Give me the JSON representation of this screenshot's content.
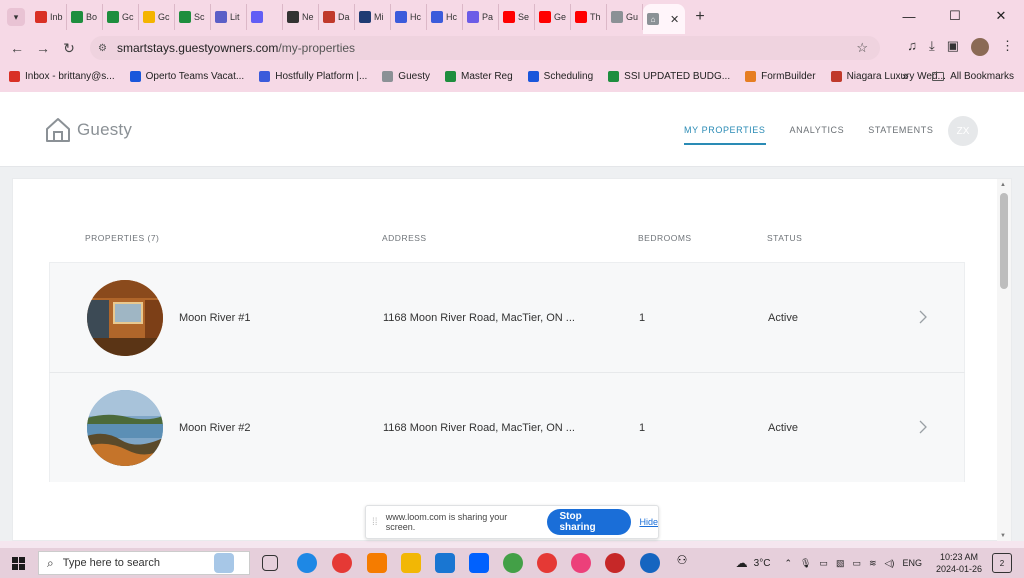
{
  "browser": {
    "tabs": [
      {
        "label": "Inb",
        "icon": "gmail-icon",
        "color": "#d93025"
      },
      {
        "label": "Bo",
        "icon": "sheets-icon",
        "color": "#1e8e3e"
      },
      {
        "label": "Gc",
        "icon": "sheets-icon",
        "color": "#1e8e3e"
      },
      {
        "label": "Gc",
        "icon": "drive-icon",
        "color": "#f4b400"
      },
      {
        "label": "Sc",
        "icon": "sheets-icon",
        "color": "#1e8e3e"
      },
      {
        "label": "Lit",
        "icon": "app-icon",
        "color": "#5b5fc7"
      },
      {
        "label": "",
        "icon": "loom-icon",
        "color": "#625df5"
      },
      {
        "label": "Ne",
        "icon": "github-icon",
        "color": "#333333"
      },
      {
        "label": "Da",
        "icon": "sk-icon",
        "color": "#c0392b"
      },
      {
        "label": "Mi",
        "icon": "b-icon",
        "color": "#1f3b73"
      },
      {
        "label": "Hc",
        "icon": "hostfully-icon",
        "color": "#3b5bdb"
      },
      {
        "label": "Hc",
        "icon": "hostfully-icon",
        "color": "#3b5bdb"
      },
      {
        "label": "Pa",
        "icon": "s-icon",
        "color": "#6c5ce7"
      },
      {
        "label": "Se",
        "icon": "youtube-icon",
        "color": "#ff0000"
      },
      {
        "label": "Ge",
        "icon": "youtube-icon",
        "color": "#ff0000"
      },
      {
        "label": "Th",
        "icon": "youtube-icon",
        "color": "#ff0000"
      },
      {
        "label": "Gu",
        "icon": "guesty-icon",
        "color": "#8b9196"
      }
    ],
    "active_tab": {
      "icon": "guesty-icon",
      "close": "✕"
    },
    "window_controls": {
      "minimize": "—",
      "maximize": "☐",
      "close": "✕"
    },
    "url_host": "smartstays.guestyowners.com",
    "url_path": "/my-properties",
    "bookmarks": [
      {
        "label": "Inbox - brittany@s...",
        "icon": "gmail-icon",
        "color": "#d93025"
      },
      {
        "label": "Operto Teams Vacat...",
        "icon": "operto-icon",
        "color": "#1a56db"
      },
      {
        "label": "Hostfully Platform |...",
        "icon": "hostfully-icon",
        "color": "#3b5bdb"
      },
      {
        "label": "Guesty",
        "icon": "guesty-icon",
        "color": "#8b9196"
      },
      {
        "label": "Master Reg",
        "icon": "sheets-icon",
        "color": "#1e8e3e"
      },
      {
        "label": "Scheduling",
        "icon": "calendar-icon",
        "color": "#1a56db"
      },
      {
        "label": "SSI UPDATED BUDG...",
        "icon": "sheets-icon",
        "color": "#1e8e3e"
      },
      {
        "label": "FormBuilder",
        "icon": "formbuilder-icon",
        "color": "#e67e22"
      },
      {
        "label": "Niagara Luxury Wed...",
        "icon": "niagara-icon",
        "color": "#c0392b"
      }
    ],
    "bookmarks_more": "»",
    "all_bookmarks": "All Bookmarks"
  },
  "site": {
    "logo_text": "Guesty",
    "nav": [
      {
        "label": "MY PROPERTIES",
        "active": true
      },
      {
        "label": "ANALYTICS",
        "active": false
      },
      {
        "label": "STATEMENTS",
        "active": false
      }
    ],
    "user_initials": "ZX"
  },
  "table": {
    "headers": {
      "properties": "PROPERTIES (7)",
      "address": "ADDRESS",
      "bedrooms": "BEDROOMS",
      "status": "STATUS"
    },
    "rows": [
      {
        "name": "Moon River #1",
        "address": "1168 Moon River Road, MacTier, ON ...",
        "bedrooms": "1",
        "status": "Active"
      },
      {
        "name": "Moon River #2",
        "address": "1168 Moon River Road, MacTier, ON ...",
        "bedrooms": "1",
        "status": "Active"
      }
    ]
  },
  "loom_bar": {
    "message": "www.loom.com is sharing your screen.",
    "stop_label": "Stop sharing",
    "hide_label": "Hide"
  },
  "taskbar": {
    "search_placeholder": "Type here to search",
    "weather": "3°C",
    "language": "ENG",
    "time": "10:23 AM",
    "date": "2024-01-26",
    "notifications": "2"
  }
}
